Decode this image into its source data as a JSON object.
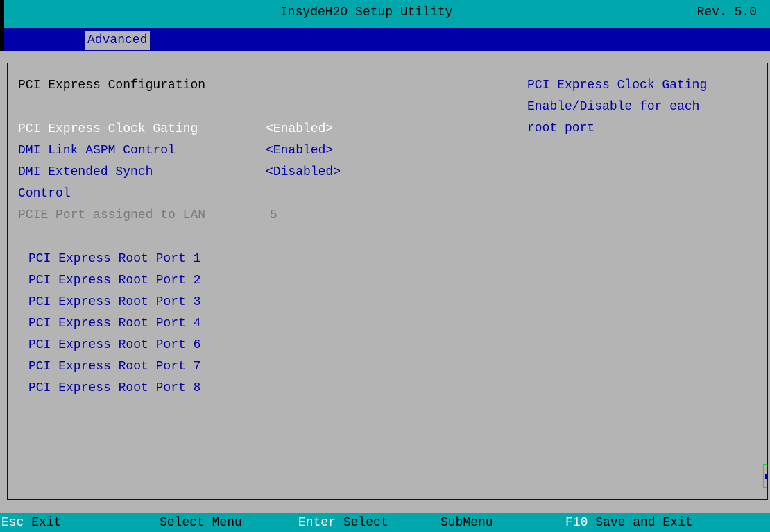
{
  "header": {
    "title": "InsydeH2O Setup Utility",
    "revision": "Rev. 5.0"
  },
  "menu": {
    "tabs": [
      {
        "label": "Advanced",
        "selected": true
      }
    ]
  },
  "main": {
    "section_title": "PCI Express Configuration",
    "settings": [
      {
        "label": "PCI Express Clock Gating",
        "value": "<Enabled>",
        "state": "selected"
      },
      {
        "label": "DMI Link ASPM Control",
        "value": "<Enabled>",
        "state": "normal"
      },
      {
        "label": "DMI Extended Synch",
        "label_line2": "Control",
        "value": "<Disabled>",
        "state": "normal"
      },
      {
        "label": "PCIE Port assigned to LAN",
        "value": "5",
        "state": "disabled"
      }
    ],
    "submenus": [
      "PCI Express Root Port 1",
      "PCI Express Root Port 2",
      "PCI Express Root Port 3",
      "PCI Express Root Port 4",
      "PCI Express Root Port 6",
      "PCI Express Root Port 7",
      "PCI Express Root Port 8"
    ]
  },
  "help": {
    "lines": [
      "PCI Express Clock Gating",
      "Enable/Disable for each",
      "root port"
    ]
  },
  "footer": {
    "keys": [
      {
        "key": "Esc",
        "action": "Exit"
      },
      {
        "key": "",
        "action": "Select Menu"
      },
      {
        "key": "Enter",
        "action": "Select"
      },
      {
        "key": "",
        "action": "SubMenu"
      },
      {
        "key": "F10",
        "action": "Save and Exit"
      }
    ]
  },
  "colors": {
    "header_bg": "#00a8ad",
    "menu_bg": "#0000a8",
    "body_bg": "#b4b4b4",
    "text_blue": "#0000a8",
    "selected_text": "#ffffff",
    "disabled_text": "#7a7a7a"
  }
}
